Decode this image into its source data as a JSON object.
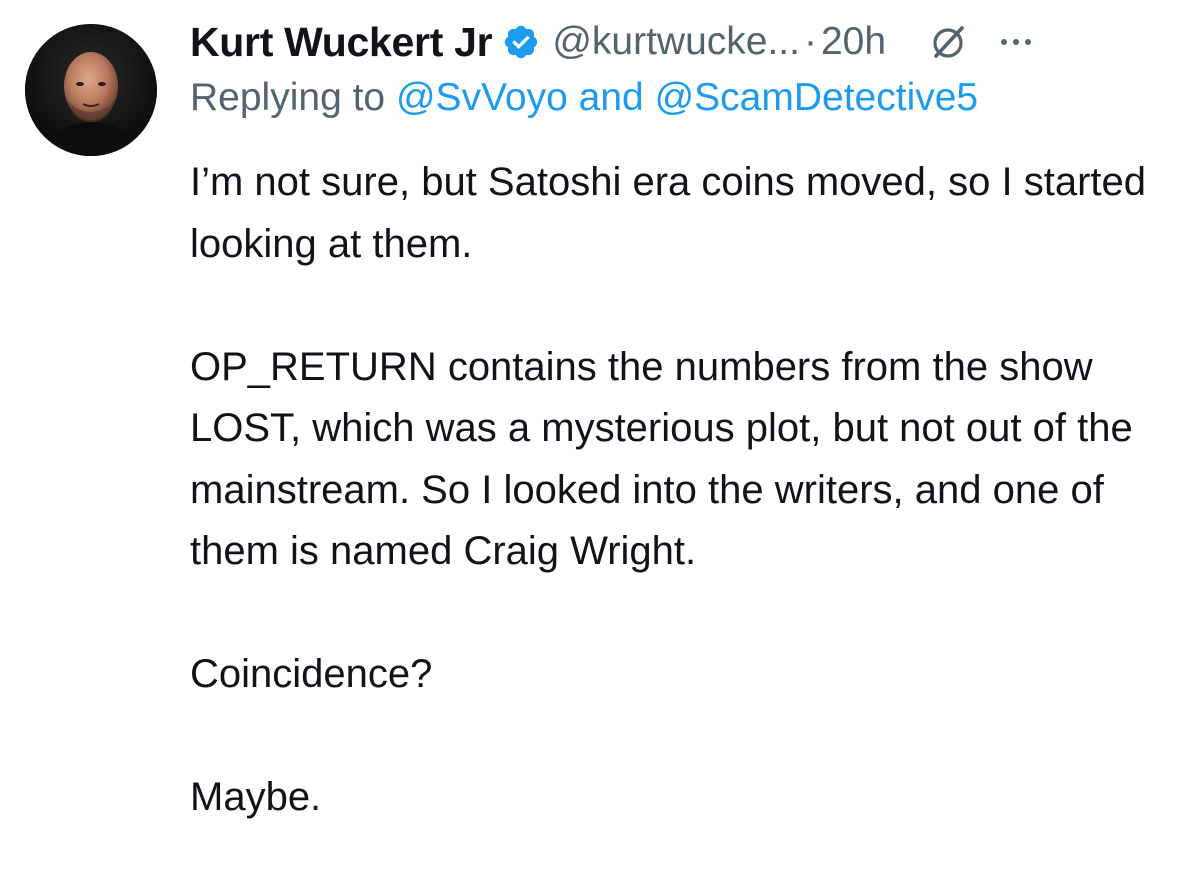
{
  "tweet": {
    "author_name": "Kurt Wuckert Jr",
    "author_handle": "@kurtwucke...",
    "separator": "·",
    "timestamp": "20h",
    "replying_prefix": "Replying to",
    "replying_mention_1": "@SvVoyo",
    "replying_conjunction": "and",
    "replying_mention_2": "@ScamDetective5",
    "paragraphs": [
      "I’m not sure, but Satoshi era coins moved, so I started looking at them.",
      "OP_RETURN contains the numbers from the show LOST, which was a mysterious plot, but not out of the mainstream. So I looked into the writers, and one of them is named Craig Wright.",
      "Coincidence?",
      "Maybe."
    ]
  },
  "icons": {
    "verified": "verified-badge-icon",
    "grok": "grok-icon",
    "more": "more-options-icon"
  },
  "colors": {
    "text_primary": "#0f1419",
    "text_secondary": "#536471",
    "link_blue": "#1d9bf0"
  }
}
